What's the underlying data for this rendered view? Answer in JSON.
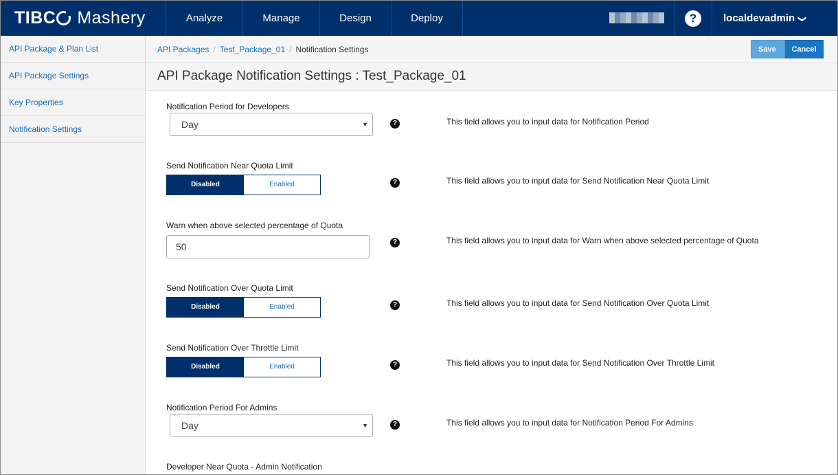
{
  "header": {
    "brand_tibco": "TIBC",
    "brand_mashery": "Mashery",
    "nav": [
      "Analyze",
      "Manage",
      "Design",
      "Deploy"
    ],
    "help_label": "?",
    "user": "localdevadmin",
    "user_chevron": "❯"
  },
  "sidebar": {
    "items": [
      {
        "label": "API Package & Plan List"
      },
      {
        "label": "API Package Settings"
      },
      {
        "label": "Key Properties"
      },
      {
        "label": "Notification Settings"
      }
    ]
  },
  "breadcrumb": {
    "items": [
      "API Packages",
      "Test_Package_01"
    ],
    "current": "Notification Settings",
    "separator": "/"
  },
  "actions": {
    "save": "Save",
    "cancel": "Cancel"
  },
  "page": {
    "title": "API Package Notification Settings : Test_Package_01"
  },
  "fields": [
    {
      "label": "Notification Period for Developers",
      "type": "select",
      "value": "Day",
      "help": "This field allows you to input data for Notification Period"
    },
    {
      "label": "Send Notification Near Quota Limit",
      "type": "toggle",
      "options": [
        "Disabled",
        "Enabled"
      ],
      "selected": "Disabled",
      "help": "This field allows you to input data for Send Notification Near Quota Limit"
    },
    {
      "label": "Warn when above selected percentage of Quota",
      "type": "text",
      "value": "50",
      "help": "This field allows you to input data for Warn when above selected percentage of Quota"
    },
    {
      "label": "Send Notification Over Quota Limit",
      "type": "toggle",
      "options": [
        "Disabled",
        "Enabled"
      ],
      "selected": "Disabled",
      "help": "This field allows you to input data for Send Notification Over Quota Limit"
    },
    {
      "label": "Send Notification Over Throttle Limit",
      "type": "toggle",
      "options": [
        "Disabled",
        "Enabled"
      ],
      "selected": "Disabled",
      "help": "This field allows you to input data for Send Notification Over Throttle Limit"
    },
    {
      "label": "Notification Period For Admins",
      "type": "select",
      "value": "Day",
      "help": "This field allows you to input data for Notification Period For Admins"
    },
    {
      "label": "Developer Near Quota - Admin Notification"
    }
  ],
  "icons": {
    "help": "question-circle-icon",
    "caret": "caret-down-icon"
  },
  "colors": {
    "brand_navy": "#00306b",
    "link_blue": "#1a6eb5",
    "save_blue": "#5ba7de",
    "cancel_blue": "#1876c4"
  }
}
